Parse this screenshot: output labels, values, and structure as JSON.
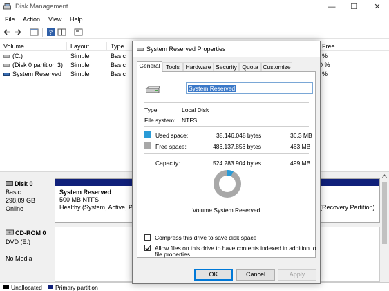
{
  "app": {
    "title": "Disk Management",
    "controls": {
      "minimize": "—",
      "maximize": "☐",
      "close": "✕"
    }
  },
  "menu": [
    "File",
    "Action",
    "View",
    "Help"
  ],
  "volumes": {
    "columns": [
      "Volume",
      "Layout",
      "Type",
      "Free"
    ],
    "rows": [
      {
        "name": "(C:)",
        "layout": "Simple",
        "type": "Basic",
        "free": "%"
      },
      {
        "name": "(Disk 0 partition 3)",
        "layout": "Simple",
        "type": "Basic",
        "free": "0 %"
      },
      {
        "name": "System Reserved",
        "layout": "Simple",
        "type": "Basic",
        "free": "%"
      }
    ]
  },
  "disks": {
    "disk0": {
      "name": "Disk 0",
      "type": "Basic",
      "size": "298,09 GB",
      "status": "Online"
    },
    "partition": {
      "name": "System Reserved",
      "size": "500 MB NTFS",
      "health": "Healthy (System, Active, P",
      "right_text": "(Recovery Partition)"
    },
    "cdrom": {
      "name": "CD-ROM 0",
      "drive": "DVD (E:)",
      "media": "No Media"
    }
  },
  "legend": [
    {
      "label": "Unallocated",
      "color": "#000000"
    },
    {
      "label": "Primary partition",
      "color": "#10207a"
    }
  ],
  "dialog": {
    "title": "System Reserved Properties",
    "tabs": [
      "General",
      "Tools",
      "Hardware",
      "Security",
      "Quota",
      "Customize"
    ],
    "active_tab": "General",
    "volume_name": "System Reserved",
    "type_label": "Type:",
    "type_value": "Local Disk",
    "fs_label": "File system:",
    "fs_value": "NTFS",
    "used": {
      "label": "Used space:",
      "bytes": "38.146.048 bytes",
      "size": "36,3 MB",
      "color": "#2a9bd7"
    },
    "free": {
      "label": "Free space:",
      "bytes": "486.137.856 bytes",
      "size": "463 MB",
      "color": "#a8a8a8"
    },
    "capacity": {
      "label": "Capacity:",
      "bytes": "524.283.904 bytes",
      "size": "499 MB"
    },
    "used_fraction": 0.0728,
    "volume_caption": "Volume System Reserved",
    "compress": {
      "label": "Compress this drive to save disk space",
      "checked": false
    },
    "index": {
      "label_line1": "Allow files on this drive to have contents indexed in addition to",
      "label_line2": "file properties",
      "checked": true
    },
    "buttons": {
      "ok": "OK",
      "cancel": "Cancel",
      "apply": "Apply"
    }
  }
}
